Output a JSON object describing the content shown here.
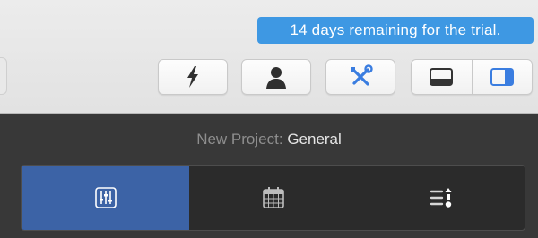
{
  "trial": {
    "message": "14 days remaining for the trial."
  },
  "toolbar": {
    "buttons": [
      {
        "icon": "lightning-icon"
      },
      {
        "icon": "person-icon"
      },
      {
        "icon": "tools-icon",
        "accent": "#3a7de0"
      }
    ],
    "layout_toggle": [
      {
        "icon": "bottom-panel-icon",
        "selected": false
      },
      {
        "icon": "right-panel-icon",
        "selected": true,
        "accent": "#3a7de0"
      }
    ]
  },
  "project": {
    "label": "New Project:",
    "name": "General"
  },
  "tabs": [
    {
      "icon": "sliders-icon",
      "selected": true,
      "accent": "#3c63a6"
    },
    {
      "icon": "calendar-icon",
      "selected": false
    },
    {
      "icon": "sort-list-icon",
      "selected": false
    }
  ]
}
